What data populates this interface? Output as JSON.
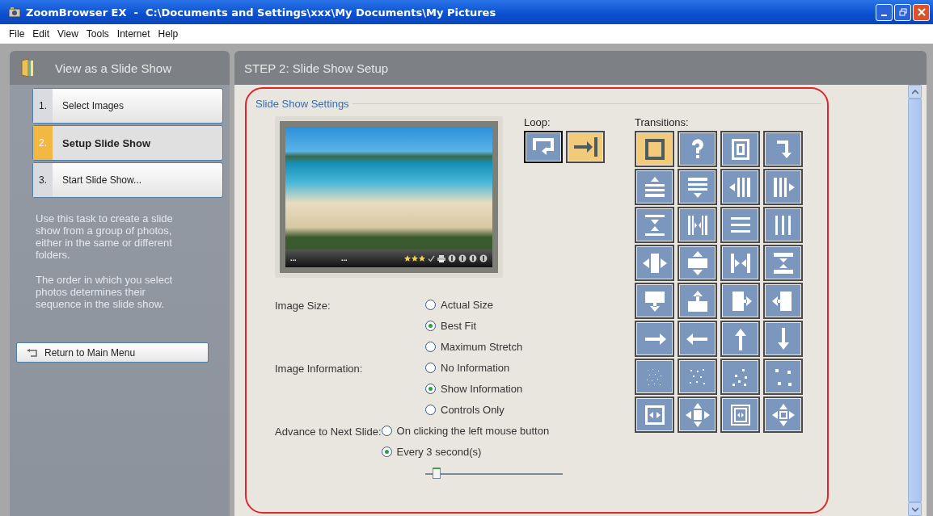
{
  "window": {
    "title": "ZoomBrowser EX  -  C:\\Documents and Settings\\xxx\\My Documents\\My Pictures"
  },
  "menu": [
    "File",
    "Edit",
    "View",
    "Tools",
    "Internet",
    "Help"
  ],
  "sidebar": {
    "title": "View as a Slide Show",
    "steps": [
      {
        "number": "1.",
        "label": "Select Images",
        "selected": false
      },
      {
        "number": "2.",
        "label": "Setup Slide Show",
        "selected": true
      },
      {
        "number": "3.",
        "label": "Start Slide Show...",
        "selected": false
      }
    ],
    "description": [
      "Use this task to create a slide show from a group of photos, either in the same or different folders.",
      "The order in which you select photos determines their sequence in the slide show."
    ],
    "return_button": "Return to Main Menu"
  },
  "main": {
    "title": "STEP 2: Slide Show Setup",
    "group_title": "Slide Show Settings",
    "preview": {
      "info_texts": [
        "...",
        "..."
      ],
      "stars": 3
    },
    "loop": {
      "label": "Loop:",
      "options": [
        {
          "kind": "repeat",
          "selected": false
        },
        {
          "kind": "stop",
          "selected": true
        }
      ]
    },
    "transitions": {
      "label": "Transitions:",
      "items": [
        {
          "kind": "box",
          "selected": true
        },
        {
          "kind": "random",
          "selected": false
        },
        {
          "kind": "spiral",
          "selected": false
        },
        {
          "kind": "spiral-corner",
          "selected": false
        },
        {
          "kind": "wipe-up",
          "selected": false
        },
        {
          "kind": "wipe-down",
          "selected": false
        },
        {
          "kind": "wipe-left",
          "selected": false
        },
        {
          "kind": "wipe-right",
          "selected": false
        },
        {
          "kind": "split-vertical",
          "selected": false
        },
        {
          "kind": "split-horizontal",
          "selected": false
        },
        {
          "kind": "blinds-horizontal",
          "selected": false
        },
        {
          "kind": "blinds-vertical",
          "selected": false
        },
        {
          "kind": "expand-horizontal",
          "selected": false
        },
        {
          "kind": "expand-vertical",
          "selected": false
        },
        {
          "kind": "squeeze-horizontal",
          "selected": false
        },
        {
          "kind": "squeeze-vertical",
          "selected": false
        },
        {
          "kind": "cover-down",
          "selected": false
        },
        {
          "kind": "cover-up",
          "selected": false
        },
        {
          "kind": "cover-right",
          "selected": false
        },
        {
          "kind": "cover-left",
          "selected": false
        },
        {
          "kind": "arrow-right",
          "selected": false
        },
        {
          "kind": "arrow-left",
          "selected": false
        },
        {
          "kind": "arrow-up",
          "selected": false
        },
        {
          "kind": "arrow-down",
          "selected": false
        },
        {
          "kind": "dissolve-fine",
          "selected": false
        },
        {
          "kind": "dissolve-medium",
          "selected": false
        },
        {
          "kind": "dissolve-coarse",
          "selected": false
        },
        {
          "kind": "dissolve-large",
          "selected": false
        },
        {
          "kind": "zoom-horizontal",
          "selected": false
        },
        {
          "kind": "zoom-out",
          "selected": false
        },
        {
          "kind": "zoom-box",
          "selected": false
        },
        {
          "kind": "zoom-center",
          "selected": false
        }
      ]
    },
    "groups": [
      {
        "label": "Image Size:",
        "options": [
          {
            "label": "Actual Size",
            "selected": false
          },
          {
            "label": "Best Fit",
            "selected": true
          },
          {
            "label": "Maximum Stretch",
            "selected": false
          }
        ]
      },
      {
        "label": "Image Information:",
        "options": [
          {
            "label": "No Information",
            "selected": false
          },
          {
            "label": "Show Information",
            "selected": true
          },
          {
            "label": "Controls Only",
            "selected": false
          }
        ]
      },
      {
        "label": "Advance to Next Slide:",
        "options": [
          {
            "label": "On clicking the left mouse button",
            "selected": false
          },
          {
            "label": "Every 3 second(s)",
            "selected": true
          }
        ]
      }
    ],
    "interval_slider": {
      "level": 0.05
    }
  }
}
